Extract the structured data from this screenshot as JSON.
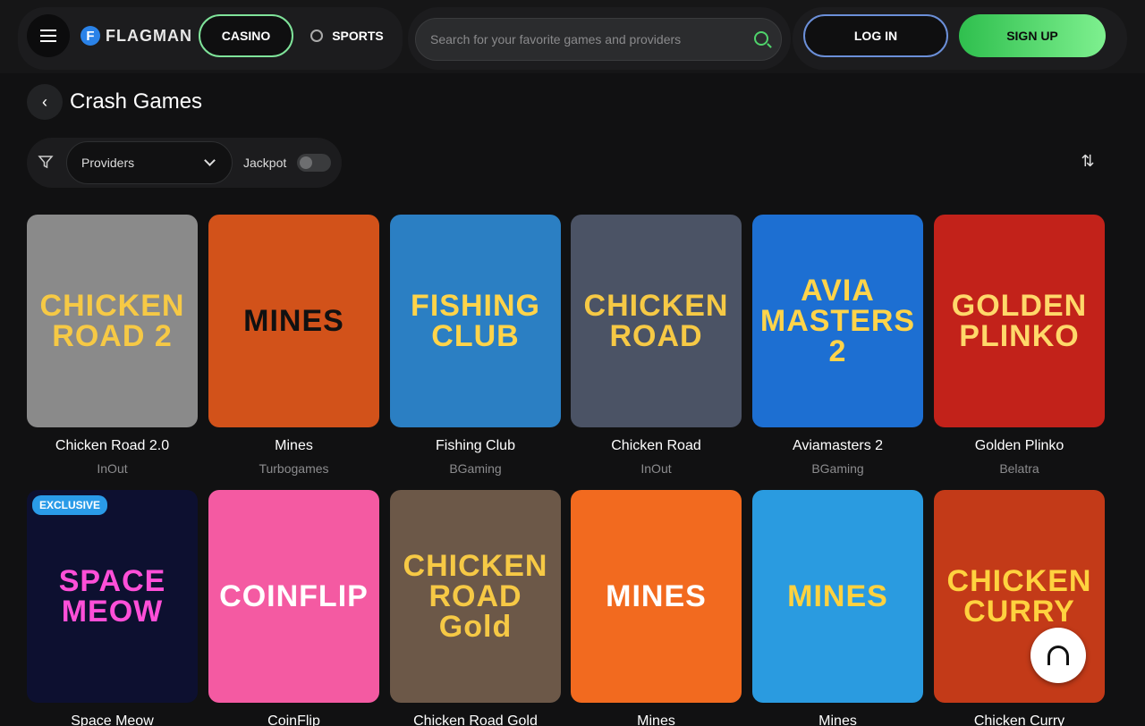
{
  "header": {
    "logo": "FLAGMAN",
    "tabs": [
      "CASINO",
      "SPORTS"
    ],
    "search_placeholder": "Search for your favorite games and providers",
    "login": "LOG IN",
    "signup": "SIGN UP"
  },
  "page": {
    "title": "Crash Games"
  },
  "filters": {
    "providers": "Providers",
    "jackpot": "Jackpot"
  },
  "games": [
    {
      "name": "Chicken Road 2.0",
      "provider": "InOut",
      "art": "CHICKEN ROAD 2",
      "bg": "#8a8a8a",
      "fg": "#f6c945"
    },
    {
      "name": "Mines",
      "provider": "Turbogames",
      "art": "MINES",
      "bg": "#d2521a",
      "fg": "#111"
    },
    {
      "name": "Fishing Club",
      "provider": "BGaming",
      "art": "FISHING CLUB",
      "bg": "#2b7fc3",
      "fg": "#ffd44a"
    },
    {
      "name": "Chicken Road",
      "provider": "InOut",
      "art": "CHICKEN ROAD",
      "bg": "#4b5365",
      "fg": "#f6c945"
    },
    {
      "name": "Aviamasters 2",
      "provider": "BGaming",
      "art": "AVIA MASTERS 2",
      "bg": "#1d6fd2",
      "fg": "#ffd44a"
    },
    {
      "name": "Golden Plinko",
      "provider": "Belatra",
      "art": "GOLDEN PLINKO",
      "bg": "#c2221a",
      "fg": "#ffd86a"
    },
    {
      "name": "Space Meow",
      "provider": "",
      "art": "SPACE MEOW",
      "bg": "#0d1030",
      "fg": "#ff4fd8",
      "badge": "EXCLUSIVE"
    },
    {
      "name": "CoinFlip",
      "provider": "",
      "art": "COINFLIP",
      "bg": "#f45aa2",
      "fg": "#fff"
    },
    {
      "name": "Chicken Road Gold",
      "provider": "",
      "art": "CHICKEN ROAD Gold",
      "bg": "#6c5848",
      "fg": "#f6c945"
    },
    {
      "name": "Mines",
      "provider": "",
      "art": "MINES",
      "bg": "#f26a1f",
      "fg": "#fff"
    },
    {
      "name": "Mines",
      "provider": "",
      "art": "MINES",
      "bg": "#2a9be0",
      "fg": "#ffd23f"
    },
    {
      "name": "Chicken Curry",
      "provider": "",
      "art": "CHICKEN CURRY",
      "bg": "#c33a18",
      "fg": "#ffd23f"
    }
  ]
}
